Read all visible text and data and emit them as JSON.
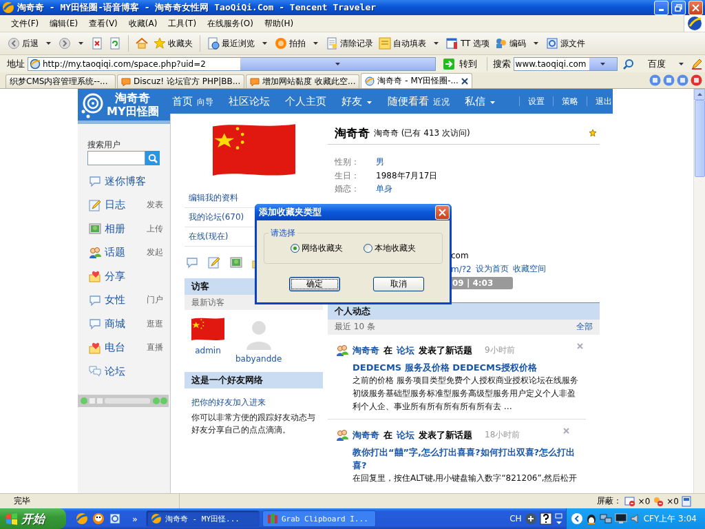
{
  "window": {
    "title": "淘奇奇 - MY田怪圈-语音博客 - 淘奇奇女性网 TaoQiQi.Com - Tencent Traveler"
  },
  "menu": [
    "文件(F)",
    "编辑(E)",
    "查看(V)",
    "收藏(A)",
    "工具(T)",
    "在线服务(O)",
    "帮助(H)"
  ],
  "toolbar": [
    {
      "kind": "back",
      "label": "后退",
      "dropdown": true
    },
    {
      "kind": "forward",
      "dropdown": true
    },
    {
      "kind": "stop",
      "dropdown": false
    },
    {
      "kind": "refresh",
      "dropdown": false
    },
    {
      "kind": "separator"
    },
    {
      "kind": "home",
      "dropdown": false
    },
    {
      "kind": "favorites",
      "label": "收藏夹",
      "dropdown": false
    },
    {
      "kind": "separator"
    },
    {
      "kind": "history",
      "label": "最近浏览",
      "dropdown": true
    },
    {
      "kind": "paipai",
      "label": "拍拍",
      "dropdown": true
    },
    {
      "kind": "clear",
      "label": "清除记录",
      "dropdown": false
    },
    {
      "kind": "autofill",
      "label": "自动填表",
      "dropdown": true
    },
    {
      "kind": "options",
      "label": "TT 选项",
      "dropdown": false
    },
    {
      "kind": "encoding",
      "label": "编码",
      "dropdown": true
    },
    {
      "kind": "source",
      "label": "源文件",
      "dropdown": false
    }
  ],
  "address": {
    "label": "地址",
    "value": "http://my.taoqiqi.com/space.php?uid=2",
    "go": "转到"
  },
  "search": {
    "label": "搜索",
    "value": "www.taoqiqi.com",
    "engine": "百度"
  },
  "tabs": [
    {
      "label": "织梦CMS内容管理系统--...",
      "selected": false
    },
    {
      "label": "Discuz! 论坛官方 PHP|BB...",
      "selected": false
    },
    {
      "label": "增加网站黏度 收藏此空...",
      "selected": false
    },
    {
      "label": "淘奇奇 - MY田怪圈-...",
      "selected": true
    }
  ],
  "site": {
    "logo": {
      "name": "淘奇奇",
      "tagline": "MY田怪圈"
    },
    "nav": [
      {
        "kind": "main",
        "label": "首页",
        "sub": "向导",
        "dropdown": false
      },
      {
        "kind": "main",
        "label": "社区论坛",
        "dropdown": false
      },
      {
        "kind": "main",
        "label": "个人主页",
        "dropdown": false
      },
      {
        "kind": "main",
        "label": "好友",
        "dropdown": true
      },
      {
        "kind": "main",
        "label": "随便看看",
        "sub": "近况",
        "dropdown": false
      },
      {
        "kind": "main",
        "label": "私信",
        "dropdown": true
      },
      {
        "kind": "minor",
        "label": "设置"
      },
      {
        "kind": "minor",
        "label": "策略"
      },
      {
        "kind": "minor",
        "label": "退出"
      }
    ]
  },
  "sidebar": {
    "search_label": "搜索用户",
    "items": [
      {
        "kind": "bubble",
        "label": "迷你博客"
      },
      {
        "kind": "pencil",
        "label": "日志",
        "action": "发表"
      },
      {
        "kind": "photo",
        "label": "相册",
        "action": "上传"
      },
      {
        "kind": "people",
        "label": "话题",
        "action": "发起"
      },
      {
        "kind": "heart",
        "label": "分享"
      },
      {
        "kind": "bubble",
        "label": "女性",
        "action": "门户"
      },
      {
        "kind": "bubble",
        "label": "商城",
        "action": "逛逛"
      },
      {
        "kind": "heart",
        "label": "电台",
        "action": "直播"
      },
      {
        "kind": "bubbles",
        "label": "论坛"
      }
    ]
  },
  "profile": {
    "links": [
      "编辑我的资料",
      "我的论坛(670)",
      "在线(现在)"
    ],
    "name": "淘奇奇",
    "subtitle": "淘奇奇 (已有 413 次访问)",
    "fields": [
      {
        "label": "性别：",
        "value": "男",
        "link": true
      },
      {
        "label": "生日：",
        "value": "1988年7月17日",
        "link": false
      },
      {
        "label": "婚恋：",
        "value": "单身",
        "link": true
      }
    ],
    "partial": {
      "email_tail": "com",
      "url_tail": "m/?2",
      "links": [
        "设为首页",
        "收藏空间"
      ],
      "player_time": "09 | 4:03"
    }
  },
  "visitors": {
    "title": "访客",
    "subtitle": "最新访客",
    "users": [
      {
        "name": "admin",
        "kind": "flag"
      },
      {
        "name": "babyandde",
        "kind": "silhouette"
      }
    ]
  },
  "friends": {
    "title": "这是一个好友网络",
    "link": "把你的好友加入进来",
    "text": "你可以非常方便的跟踪好友动态与好友分享自己的点点滴滴。"
  },
  "feed": {
    "title": "个人动态",
    "count": "最近 10 条",
    "all": "全部",
    "items": [
      {
        "user": "淘奇奇",
        "prep": "在",
        "place": "论坛",
        "action": "发表了新话题",
        "time": "9小时前",
        "title": "DEDECMS 服务及价格 DEDECMS授权价格",
        "body": "之前的价格 服务项目类型免费个人授权商业授权论坛在线服务初级服务基础型服务标准型服务高级型服务用户定义个人非盈利个人企、事业所有所有所有所有所有去 …"
      },
      {
        "user": "淘奇奇",
        "prep": "在",
        "place": "论坛",
        "action": "发表了新话题",
        "time": "18小时前",
        "title": "教你打出“囍”字,怎么打出喜喜?如何打出双喜?怎么打出喜?",
        "body": "在回复里，按住ALT键,用小键盘输入数字“821206”,然后松开"
      }
    ]
  },
  "dialog": {
    "title": "添加收藏夹类型",
    "group": "请选择",
    "options": [
      {
        "label": "网络收藏夹",
        "selected": true
      },
      {
        "label": "本地收藏夹",
        "selected": false
      }
    ],
    "buttons": [
      {
        "label": "确定",
        "default": true
      },
      {
        "label": "取消",
        "default": false
      }
    ]
  },
  "status_bar": {
    "text": "完毕",
    "block_label": "屏蔽：",
    "popups": "×0",
    "ads": "×0"
  },
  "taskbar": {
    "start": "开始",
    "more": "»",
    "tasks": [
      {
        "label": "淘奇奇 - MY田怪...",
        "kind": "browser",
        "selected": true
      },
      {
        "label": "Grab Clipboard I...",
        "kind": "books",
        "selected": false
      }
    ],
    "lang": "CH",
    "clock": "CFY上午 3:04"
  }
}
